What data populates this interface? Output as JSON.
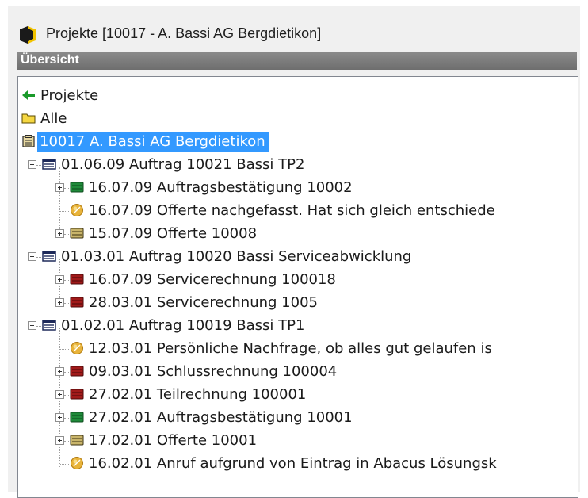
{
  "window": {
    "title": "Projekte [10017 - A. Bassi AG Bergdietikon]",
    "icon": "app-logo-icon"
  },
  "section": {
    "title": "Übersicht"
  },
  "tree": {
    "nav_back": {
      "label": "Projekte",
      "icon": "green-back-arrow-icon"
    },
    "all": {
      "label": "Alle",
      "icon": "yellow-folder-icon"
    },
    "project": {
      "label": "10017 A. Bassi AG Bergdietikon",
      "icon": "project-binder-icon",
      "selected": true
    },
    "orders": [
      {
        "label": "01.06.09 Auftrag 10021 Bassi TP2",
        "icon": "navy-binder-icon",
        "expanded": true,
        "children": [
          {
            "label": "16.07.09 Auftragsbestätigung 10002",
            "icon": "green-binder-icon",
            "expandable": true
          },
          {
            "label": "16.07.09 Offerte nachgefasst. Hat sich gleich entschiede",
            "icon": "gold-note-icon",
            "expandable": false
          },
          {
            "label": "15.07.09 Offerte 10008",
            "icon": "tan-binder-icon",
            "expandable": true
          }
        ]
      },
      {
        "label": "01.03.01 Auftrag 10020 Bassi Serviceabwicklung",
        "icon": "navy-binder-icon",
        "expanded": true,
        "children": [
          {
            "label": "16.07.09 Servicerechnung 100018",
            "icon": "red-binder-icon",
            "expandable": true
          },
          {
            "label": "28.03.01 Servicerechnung 1005",
            "icon": "red-binder-icon",
            "expandable": true
          }
        ]
      },
      {
        "label": "01.02.01 Auftrag 10019 Bassi TP1",
        "icon": "navy-binder-icon",
        "expanded": true,
        "children": [
          {
            "label": "12.03.01 Persönliche Nachfrage, ob alles gut gelaufen is",
            "icon": "gold-note-icon",
            "expandable": false
          },
          {
            "label": "09.03.01 Schlussrechnung 100004",
            "icon": "red-binder-icon",
            "expandable": true
          },
          {
            "label": "27.02.01 Teilrechnung 100001",
            "icon": "red-binder-icon",
            "expandable": true
          },
          {
            "label": "27.02.01 Auftragsbestätigung 10001",
            "icon": "green-binder-icon",
            "expandable": true
          },
          {
            "label": "17.02.01 Offerte 10001",
            "icon": "tan-binder-icon",
            "expandable": true
          },
          {
            "label": "16.02.01 Anruf aufgrund von Eintrag in Abacus Lösungsk",
            "icon": "gold-note-icon",
            "expandable": false
          }
        ]
      }
    ]
  },
  "colors": {
    "selection": "#3399ff",
    "section_bar": "#787878",
    "green_binder": "#1f8a3a",
    "red_binder": "#a11a1a",
    "tan_binder": "#c8b46a",
    "navy_binder": "#1e2a5a",
    "gold_note": "#e8b33a",
    "back_arrow": "#1a9a2a",
    "folder": "#f5d742"
  }
}
